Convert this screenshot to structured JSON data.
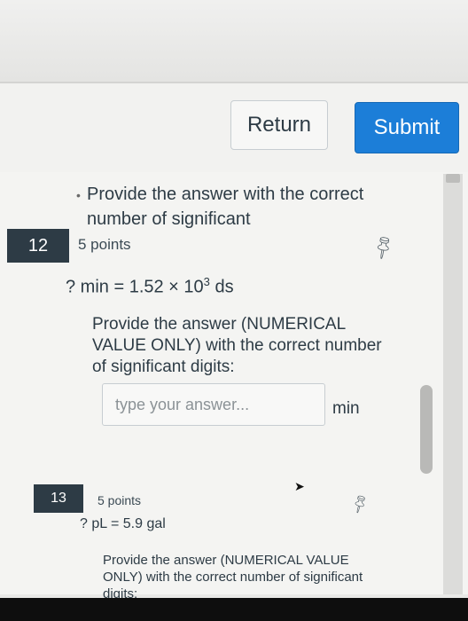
{
  "toolbar": {
    "return_label": "Return",
    "submit_label": "Submit",
    "accent_color": "#1c7ed8"
  },
  "previous_question": {
    "instruction": "Provide the answer with the correct number of significant"
  },
  "questions": [
    {
      "number": "12",
      "points": "5 points",
      "equation_prefix": "? min = 1.52 × 10",
      "equation_exponent": "3",
      "equation_suffix": " ds",
      "instruction": "Provide the answer (NUMERICAL VALUE ONLY) with the correct number of significant digits:",
      "answer_placeholder": "type your answer...",
      "unit": "min",
      "pin_icon": "pin-icon"
    },
    {
      "number": "13",
      "points": "5 points",
      "equation": "? pL = 5.9 gal",
      "instruction": "Provide the answer (NUMERICAL VALUE ONLY) with the correct number of significant digits:",
      "pin_icon": "pin-icon"
    }
  ]
}
